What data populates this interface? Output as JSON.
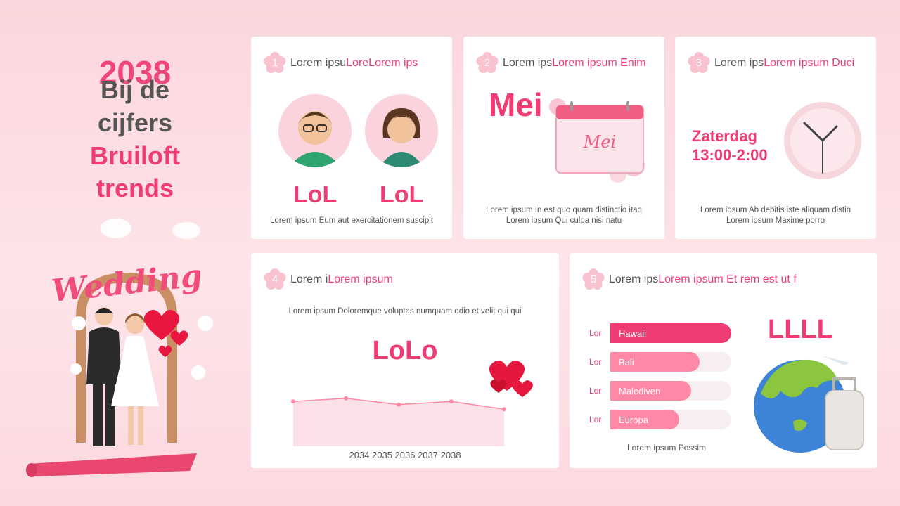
{
  "left": {
    "year": "2038",
    "title_line1": "Bij de",
    "title_line2": "cijfers",
    "title_line3": "Bruiloft",
    "title_line4": "trends",
    "sign_text": "Wedding"
  },
  "card1": {
    "number": "1",
    "head_grey": "Lorem ipsu",
    "head_pink": "LoreLorem ips",
    "person1_value": "LoL",
    "person2_value": "LoL",
    "caption": "Lorem ipsum Eum aut exercitationem suscipit"
  },
  "card2": {
    "number": "2",
    "head_grey": "Lorem ips",
    "head_pink": "Lorem ipsum Enim",
    "big_text": "Mei",
    "calendar_text": "Mei",
    "caption_line1": "Lorem ipsum In est quo quam distinctio itaq",
    "caption_line2": "Lorem ipsum Qui culpa nisi natu"
  },
  "card3": {
    "number": "3",
    "head_grey": "Lorem ips",
    "head_pink": "Lorem ipsum Duci",
    "day": "Zaterdag",
    "time": "13:00-2:00",
    "caption_line1": "Lorem ipsum Ab debitis iste aliquam distin",
    "caption_line2": "Lorem ipsum Maxime porro"
  },
  "card4": {
    "number": "4",
    "head_grey": "Lorem i",
    "head_pink": "Lorem ipsum",
    "description": "Lorem ipsum Doloremque voluptas numquam odio et velit qui qui",
    "big_value": "LoLo",
    "axis_labels": "2034 2035 2036 2037 2038"
  },
  "card5": {
    "number": "5",
    "head_grey": "Lorem ips",
    "head_pink": "Lorem ipsum Et rem est ut f",
    "big_value": "LLLL",
    "footer": "Lorem ipsum Possim",
    "bars": [
      {
        "label": "Lor",
        "name": "Hawaii",
        "value": 1.0
      },
      {
        "label": "Lor",
        "name": "Bali",
        "value": 0.74
      },
      {
        "label": "Lor",
        "name": "Malediven",
        "value": 0.67
      },
      {
        "label": "Lor",
        "name": "Europa",
        "value": 0.57
      }
    ]
  },
  "chart_data": {
    "type": "area",
    "x": [
      "2034",
      "2035",
      "2036",
      "2037",
      "2038"
    ],
    "series": [
      {
        "values": [
          58,
          62,
          54,
          58,
          48
        ]
      }
    ],
    "ylim": [
      0,
      100
    ],
    "grid": false
  },
  "colors": {
    "accent": "#ef3d74",
    "accent_light": "#fe88a6",
    "area_fill": "#fde1e8",
    "badge": "#f9c2cf"
  }
}
